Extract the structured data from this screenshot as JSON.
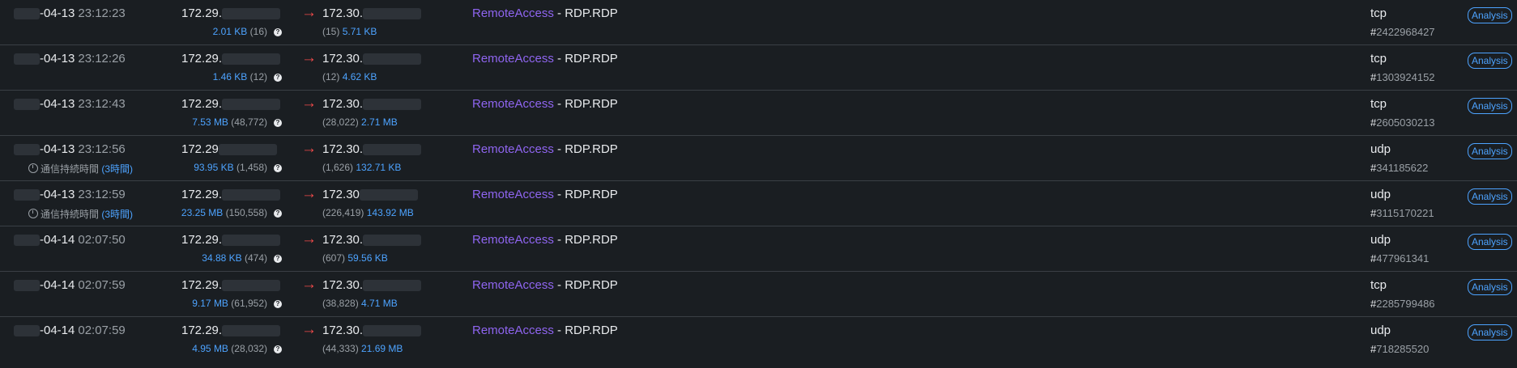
{
  "action_label": "Analysis",
  "arrow_glyph": "→",
  "separator": " - ",
  "rows": [
    {
      "date": "-04-13",
      "time": "23:12:23",
      "src": "172.29.",
      "src_size": "2.01 KB",
      "src_pkts": "(16)",
      "dst": "172.30.",
      "dst_pkts": "(15)",
      "dst_size": "5.71 KB",
      "category": "RemoteAccess",
      "app": "RDP.RDP",
      "proto": "tcp",
      "session": "2422968427",
      "duration_label": "",
      "duration_value": ""
    },
    {
      "date": "-04-13",
      "time": "23:12:26",
      "src": "172.29.",
      "src_size": "1.46 KB",
      "src_pkts": "(12)",
      "dst": "172.30.",
      "dst_pkts": "(12)",
      "dst_size": "4.62 KB",
      "category": "RemoteAccess",
      "app": "RDP.RDP",
      "proto": "tcp",
      "session": "1303924152",
      "duration_label": "",
      "duration_value": ""
    },
    {
      "date": "-04-13",
      "time": "23:12:43",
      "src": "172.29.",
      "src_size": "7.53 MB",
      "src_pkts": "(48,772)",
      "dst": "172.30.",
      "dst_pkts": "(28,022)",
      "dst_size": "2.71 MB",
      "category": "RemoteAccess",
      "app": "RDP.RDP",
      "proto": "tcp",
      "session": "2605030213",
      "duration_label": "",
      "duration_value": ""
    },
    {
      "date": "-04-13",
      "time": "23:12:56",
      "src": "172.29",
      "src_size": "93.95 KB",
      "src_pkts": "(1,458)",
      "dst": "172.30.",
      "dst_pkts": "(1,626)",
      "dst_size": "132.71 KB",
      "category": "RemoteAccess",
      "app": "RDP.RDP",
      "proto": "udp",
      "session": "341185622",
      "duration_label": "通信持続時間",
      "duration_value": "(3時間)"
    },
    {
      "date": "-04-13",
      "time": "23:12:59",
      "src": "172.29.",
      "src_size": "23.25 MB",
      "src_pkts": "(150,558)",
      "dst": "172.30",
      "dst_pkts": "(226,419)",
      "dst_size": "143.92 MB",
      "category": "RemoteAccess",
      "app": "RDP.RDP",
      "proto": "udp",
      "session": "3115170221",
      "duration_label": "通信持続時間",
      "duration_value": "(3時間)"
    },
    {
      "date": "-04-14",
      "time": "02:07:50",
      "src": "172.29.",
      "src_size": "34.88 KB",
      "src_pkts": "(474)",
      "dst": "172.30.",
      "dst_pkts": "(607)",
      "dst_size": "59.56 KB",
      "category": "RemoteAccess",
      "app": "RDP.RDP",
      "proto": "udp",
      "session": "477961341",
      "duration_label": "",
      "duration_value": ""
    },
    {
      "date": "-04-14",
      "time": "02:07:59",
      "src": "172.29.",
      "src_size": "9.17 MB",
      "src_pkts": "(61,952)",
      "dst": "172.30.",
      "dst_pkts": "(38,828)",
      "dst_size": "4.71 MB",
      "category": "RemoteAccess",
      "app": "RDP.RDP",
      "proto": "tcp",
      "session": "2285799486",
      "duration_label": "",
      "duration_value": ""
    },
    {
      "date": "-04-14",
      "time": "02:07:59",
      "src": "172.29.",
      "src_size": "4.95 MB",
      "src_pkts": "(28,032)",
      "dst": "172.30.",
      "dst_pkts": "(44,333)",
      "dst_size": "21.69 MB",
      "category": "RemoteAccess",
      "app": "RDP.RDP",
      "proto": "udp",
      "session": "718285520",
      "duration_label": "",
      "duration_value": ""
    }
  ]
}
